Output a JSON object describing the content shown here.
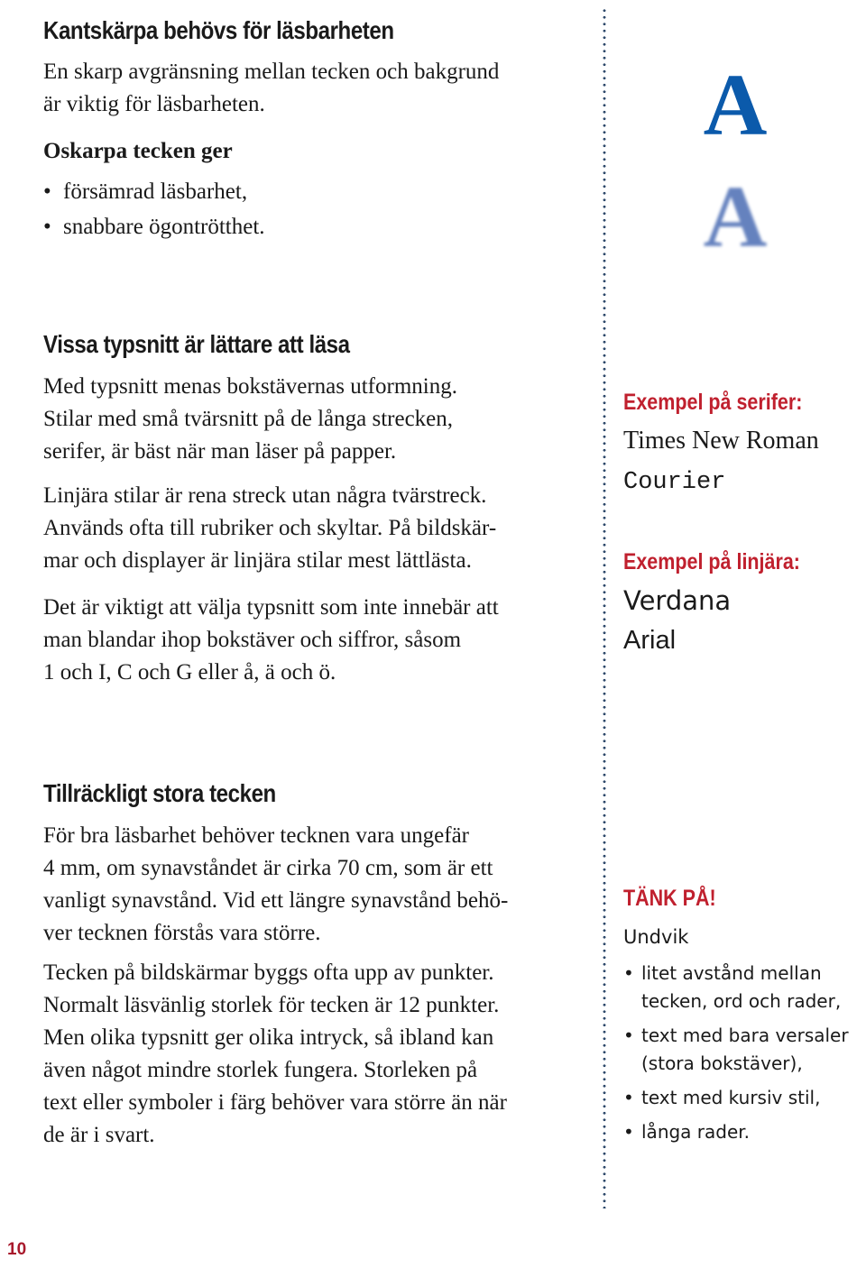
{
  "page_number": "10",
  "colors": {
    "heading_red": "#c0202e",
    "letter_blue": "#0b5aab",
    "page_number": "#a8192c",
    "divider": "#2f4a6b"
  },
  "section1": {
    "heading": "Kantskärpa behövs för läsbarheten",
    "intro_lines": [
      "En skarp avgränsning mellan tecken och bakgrund",
      "är viktig för läsbarheten."
    ],
    "subheading": "Oskarpa tecken ger",
    "bullets": [
      "försämrad läsbarhet,",
      "snabbare ögontrötthet."
    ],
    "sharp_letter": "A",
    "blurred_letter": "A"
  },
  "section2": {
    "heading": "Vissa typsnitt är lättare att läsa",
    "para1": [
      "Med typsnitt menas bokstävernas utformning.",
      "Stilar med små tvärsnitt på de långa strecken,",
      "serifer, är bäst när man läser på papper."
    ],
    "para2": [
      "Linjära stilar är rena streck utan några tvärstreck.",
      "Används ofta till rubriker och skyltar. På bildskär-",
      "mar och displayer är linjära stilar mest lättlästa."
    ],
    "para3": [
      "Det är viktigt att välja typsnitt som inte innebär att",
      "man blandar ihop bokstäver och siffror, såsom",
      "1 och I, C och G eller å, ä och ö."
    ],
    "side": {
      "serif_heading": "Exempel på serifer:",
      "serif_examples": [
        "Times New Roman",
        "Courier"
      ],
      "sans_heading": "Exempel på linjära:",
      "sans_examples": [
        "Verdana",
        "Arial"
      ]
    }
  },
  "section3": {
    "heading": "Tillräckligt stora tecken",
    "para1": [
      "För bra läsbarhet behöver tecknen vara ungefär",
      "4 mm, om synavståndet är cirka 70 cm, som är ett",
      "vanligt synavstånd. Vid ett längre synavstånd behö-",
      "ver tecknen förstås vara större."
    ],
    "para2": [
      "Tecken på bildskärmar byggs ofta upp av punkter.",
      "Normalt läsvänlig storlek för tecken är 12 punkter.",
      "Men olika typsnitt ger olika intryck, så ibland kan",
      "även något mindre storlek fungera. Storleken på",
      "text eller symboler i färg behöver vara större än när",
      "de är i svart."
    ],
    "side": {
      "heading": "TÄNK PÅ!",
      "intro": "Undvik",
      "bullets": [
        [
          "litet avstånd mellan",
          "tecken, ord och rader,"
        ],
        [
          "text med bara versaler",
          "(stora bokstäver),"
        ],
        [
          "text med kursiv stil,"
        ],
        [
          "långa rader."
        ]
      ]
    }
  }
}
